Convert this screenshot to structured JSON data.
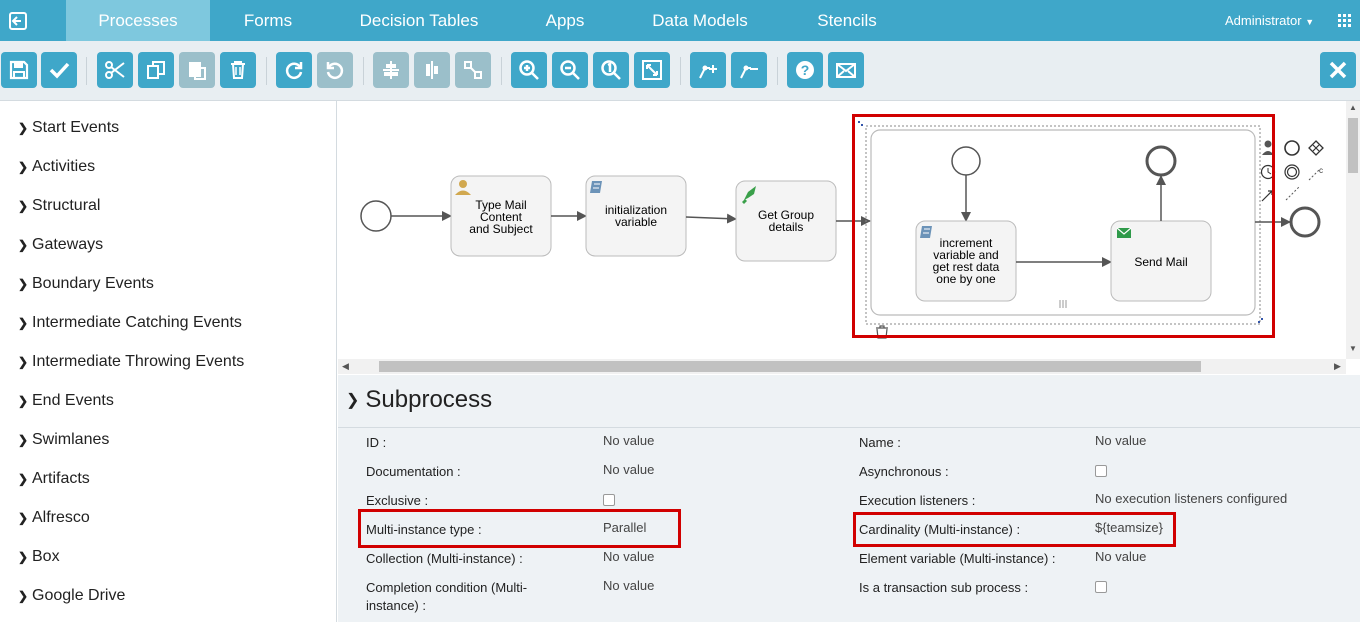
{
  "nav": {
    "tabs": [
      "Processes",
      "Forms",
      "Decision Tables",
      "Apps",
      "Data Models",
      "Stencils"
    ],
    "user": "Administrator"
  },
  "toolbar": {
    "buttons": [
      "save-icon",
      "validate-icon",
      "cut-icon",
      "copy-icon",
      "paste-icon",
      "delete-icon",
      "redo-icon",
      "undo-icon",
      "align-horizontal-icon",
      "align-vertical-icon",
      "same-size-icon",
      "zoom-in-icon",
      "zoom-out-icon",
      "zoom-actual-icon",
      "zoom-fit-icon",
      "bend-point-add-icon",
      "bend-point-remove-icon",
      "help-icon",
      "feedback-icon",
      "close-icon"
    ],
    "disabled": [
      "paste-icon",
      "undo-icon",
      "align-vertical-icon",
      "same-size-icon"
    ]
  },
  "palette": {
    "items": [
      "Start Events",
      "Activities",
      "Structural",
      "Gateways",
      "Boundary Events",
      "Intermediate Catching Events",
      "Intermediate Throwing Events",
      "End Events",
      "Swimlanes",
      "Artifacts",
      "Alfresco",
      "Box",
      "Google Drive"
    ]
  },
  "diagram": {
    "tasks": {
      "type_mail": [
        "Type Mail",
        "Content",
        "and Subject"
      ],
      "init_var": [
        "initialization",
        "variable"
      ],
      "get_group": [
        "Get Group",
        "details"
      ],
      "increment": [
        "increment",
        "variable and",
        "get rest data",
        "one by one"
      ],
      "send_mail": [
        "Send Mail"
      ]
    }
  },
  "properties": {
    "title": "Subprocess",
    "left": [
      {
        "label": "ID :",
        "value": "No value"
      },
      {
        "label": "Documentation :",
        "value": "No value"
      },
      {
        "label": "Exclusive :",
        "value": ""
      },
      {
        "label": "Multi-instance type :",
        "value": "Parallel"
      },
      {
        "label": "Collection (Multi-instance) :",
        "value": "No value"
      },
      {
        "label": "Completion condition (Multi-",
        "label2": "instance) :",
        "value": "No value"
      }
    ],
    "right": [
      {
        "label": "Name :",
        "value": "No value"
      },
      {
        "label": "Asynchronous :",
        "value": ""
      },
      {
        "label": "Execution listeners :",
        "value": "No execution listeners configured"
      },
      {
        "label": "Cardinality (Multi-instance) :",
        "value": "${teamsize}"
      },
      {
        "label": "Element variable (Multi-instance) :",
        "value": "No value"
      },
      {
        "label": "Is a transaction sub process :",
        "value": ""
      }
    ]
  },
  "colors": {
    "accent": "#3fa7c9",
    "highlight": "#d10000",
    "task_fill": "#f4f4f4"
  }
}
